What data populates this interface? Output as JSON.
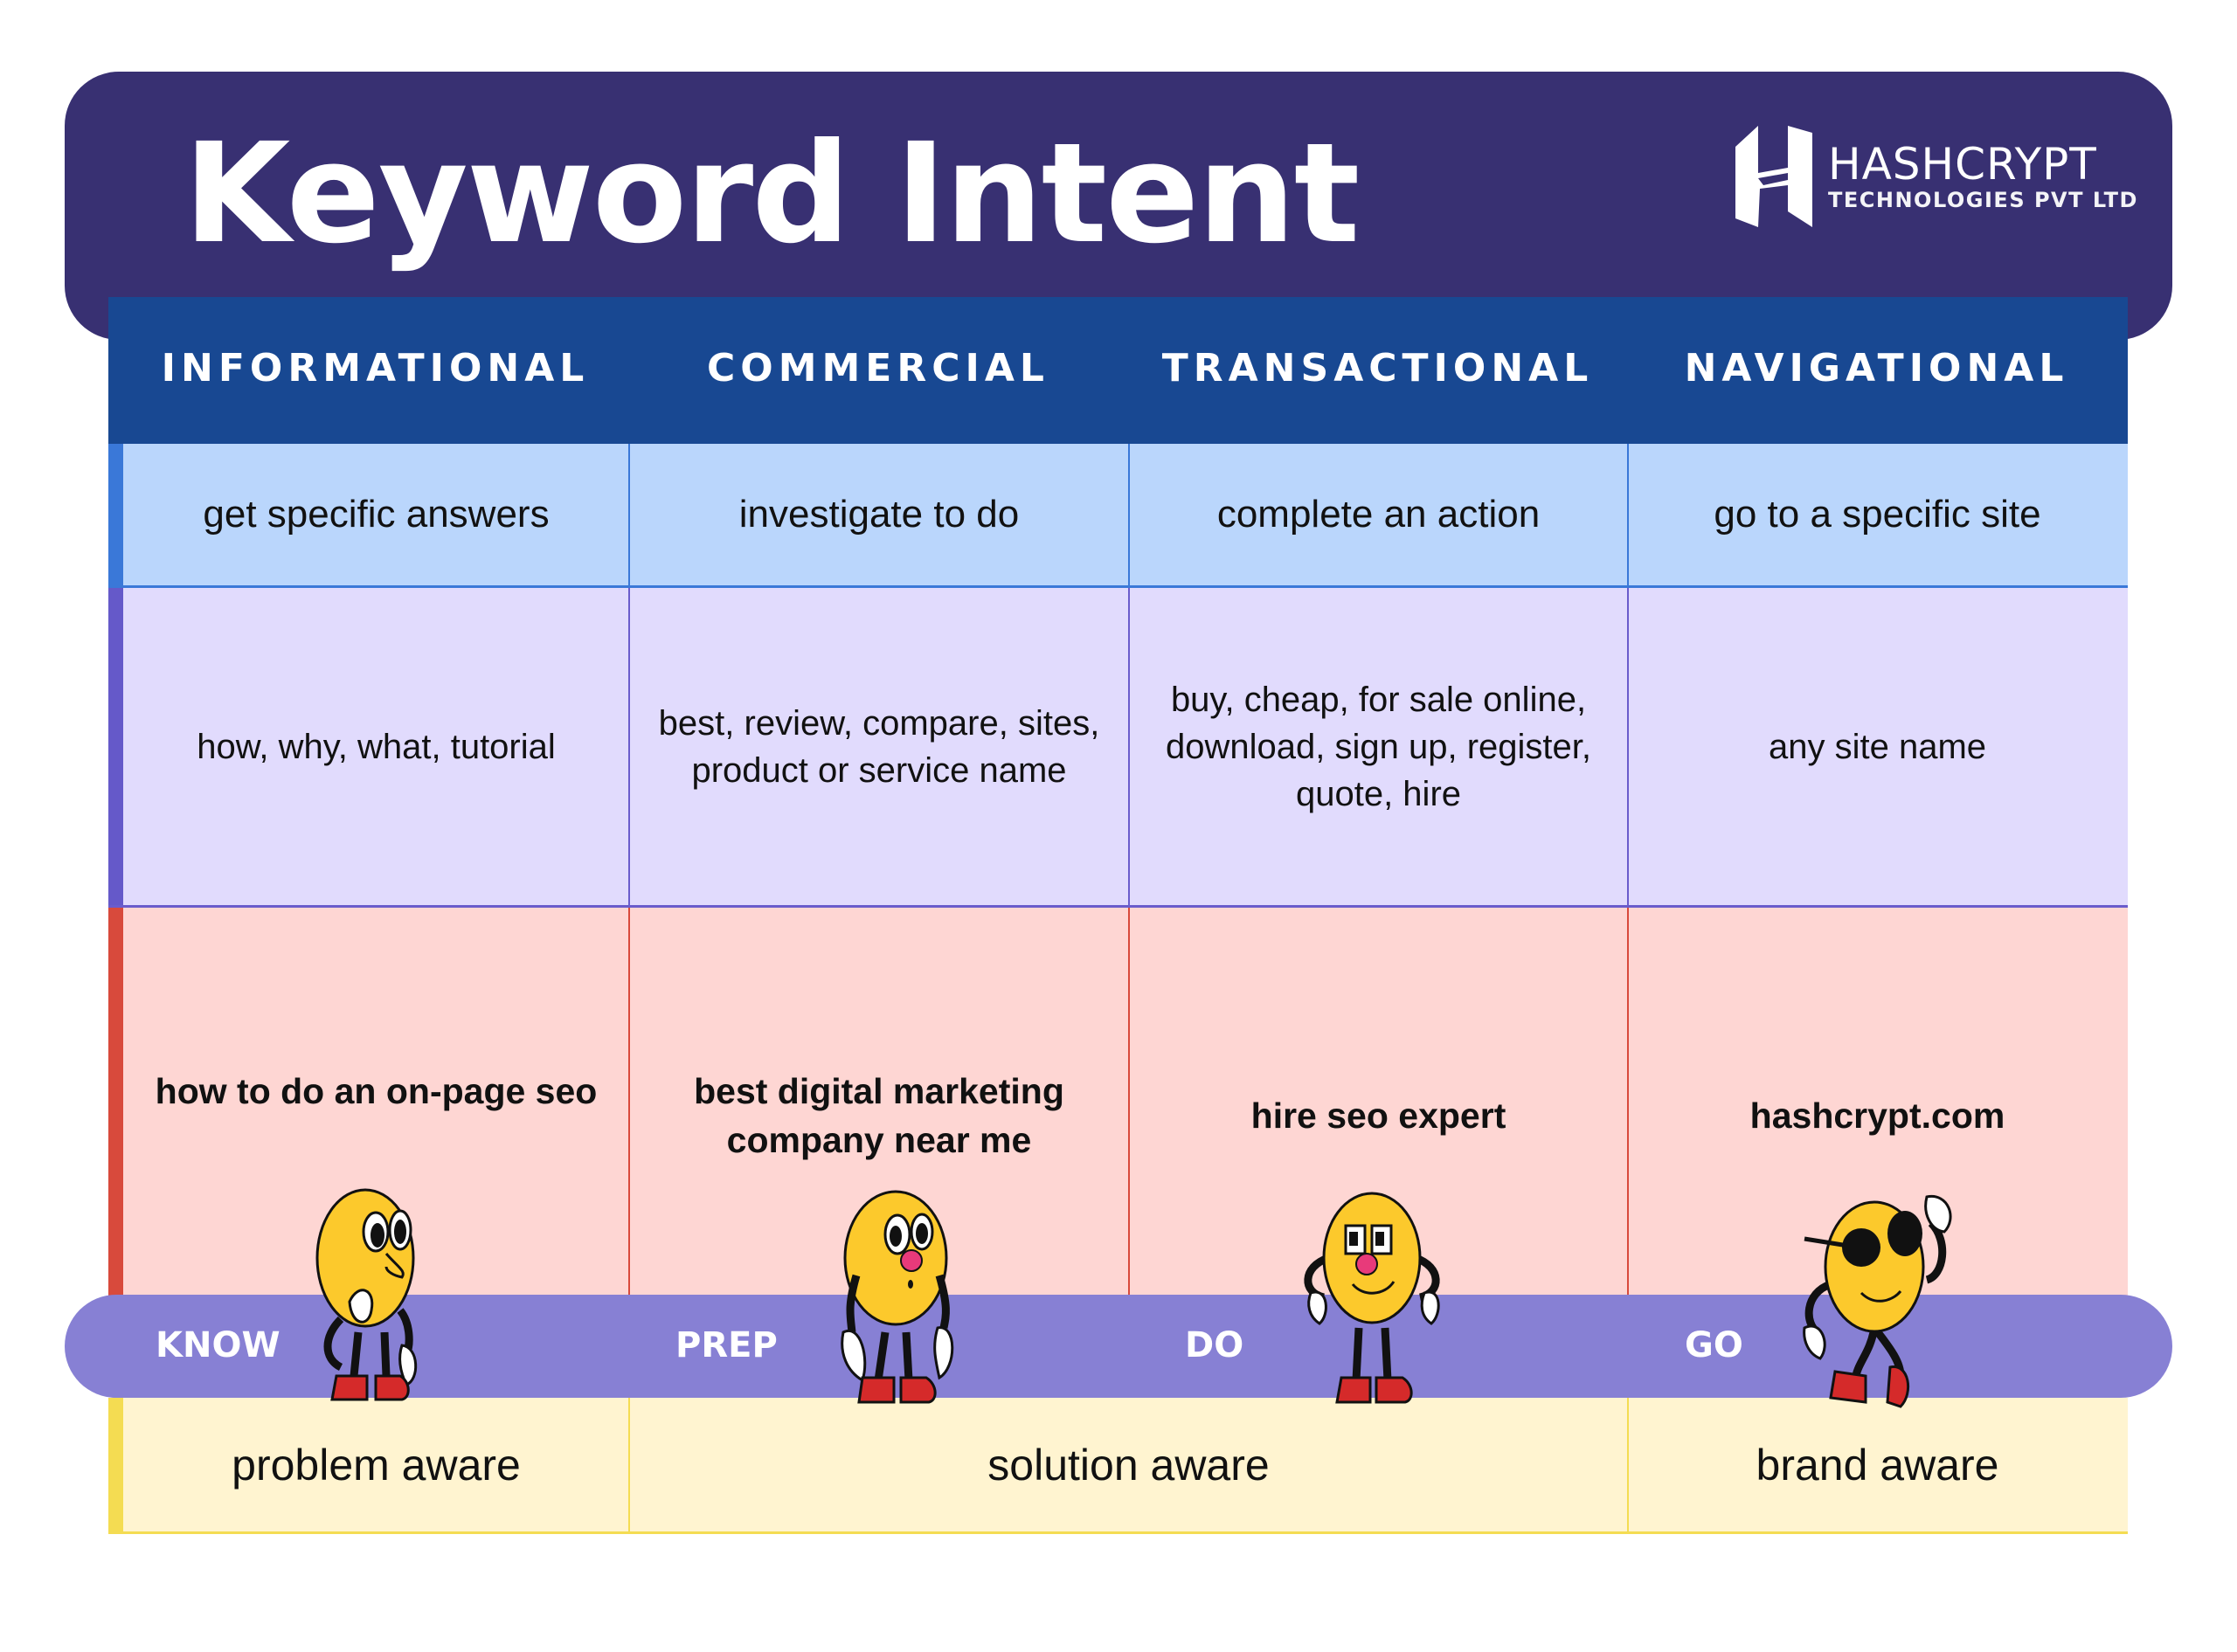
{
  "header": {
    "title": "Keyword Intent",
    "logo": {
      "icon": "hashcrypt-h-logo-icon",
      "name": "HASHCRYPT",
      "subtitle": "TECHNOLOGIES PVT LTD"
    }
  },
  "colors": {
    "header_band": "#383072",
    "column_header": "#184892",
    "row_goal": "#bad6fc",
    "row_modifiers": "#e1dbfd",
    "row_example": "#fed6d3",
    "row_awareness": "#fff4d0",
    "stage_band": "#8780d4",
    "character_body": "#fcc92c",
    "character_shoes": "#d52a2a"
  },
  "table": {
    "columns": [
      "INFORMATIONAL",
      "COMMERCIAL",
      "TRANSACTIONAL",
      "NAVIGATIONAL"
    ],
    "goal_row": [
      "get specific answers",
      "investigate to do",
      "complete an action",
      "go to a specific site"
    ],
    "modifier_row": [
      "how, why, what, tutorial",
      "best, review, compare, sites, product or service name",
      "buy, cheap, for sale online, download, sign up, register, quote, hire",
      "any site name"
    ],
    "example_row": [
      "how to do an on-page seo",
      "best digital marketing company near me",
      "hire seo expert",
      "hashcrypt.com"
    ],
    "awareness_row": [
      "problem aware",
      "solution aware",
      "brand aware"
    ]
  },
  "stages": [
    {
      "label": "KNOW",
      "character": "thinking-emoji-character-icon"
    },
    {
      "label": "PREP",
      "character": "surprised-emoji-character-icon"
    },
    {
      "label": "DO",
      "character": "confident-emoji-character-icon"
    },
    {
      "label": "GO",
      "character": "cool-sunglasses-emoji-character-icon"
    }
  ]
}
